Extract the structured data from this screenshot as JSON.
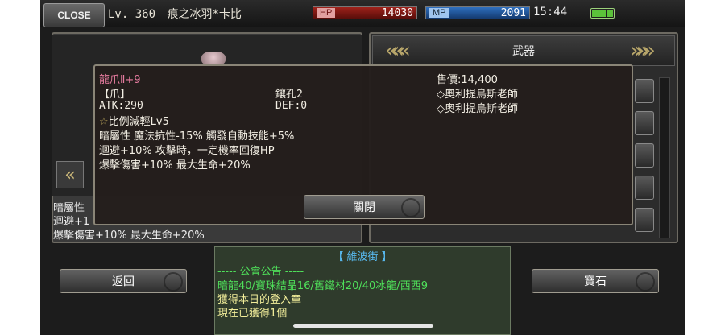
{
  "topbar": {
    "close_label": "CLOSE",
    "level": "Lv. 360",
    "character_name": "痕之冰羽*卡比",
    "hp_label": "HP",
    "hp_value": "14030",
    "mp_label": "MP",
    "mp_value": "2091",
    "clock": "15:44",
    "battery_icon": "battery-icon"
  },
  "shop": {
    "category": "武器"
  },
  "tooltip": {
    "item_name": "龍爪Ⅱ+9",
    "item_type": "【爪】",
    "sockets": "鑲孔2",
    "atk": "ATK:290",
    "def": "DEF:0",
    "price": "售價:14,400",
    "vendor_1": "◇奧利提烏斯老師",
    "vendor_2": "◇奧利提烏斯老師",
    "star": "☆",
    "skill": "比例減輕Lv5",
    "line_1": "暗屬性 魔法抗性-15% 觸發自動技能+5%",
    "line_2": "迴避+10% 攻擊時，一定機率回復HP",
    "line_3": "爆擊傷害+10% 最大生命+20%",
    "close_button": "關閉"
  },
  "left_stats": {
    "line_1": "暗屬性",
    "line_2": "迴避+1",
    "line_3": "爆擊傷害+10% 最大生命+20%"
  },
  "bottom": {
    "back_button": "返回",
    "gem_button": "寶石"
  },
  "chat": {
    "title": "【 維波街 】",
    "line_1": "----- 公會公告 -----",
    "line_2": "暗龍40/寶珠結晶16/舊鐵材20/40冰龍/西西9",
    "line_3": "獲得本日的登入章",
    "line_4": "現在已獲得1個"
  }
}
